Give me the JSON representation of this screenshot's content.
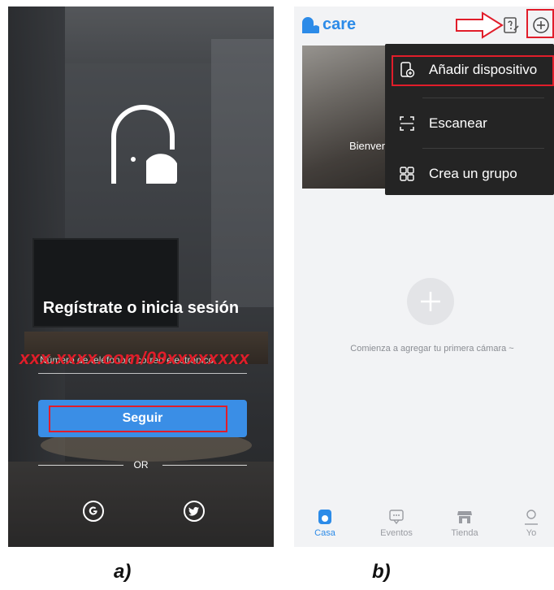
{
  "panel_a": {
    "title": "Regístrate o inicia sesión",
    "phone_placeholder": "Número de teléfono o correo electrónico",
    "redacted_overlay": "xxx.xxxx.com/09xxxxxxxx",
    "continue_label": "Seguir",
    "or_label": "OR",
    "caption": "a)",
    "icons": [
      "house-logo-icon",
      "google-icon",
      "twitter-icon"
    ]
  },
  "panel_b": {
    "app_name": "care",
    "banner_text": "Bienvenido a usar care",
    "menu": {
      "items": [
        {
          "label": "Añadir dispositivo",
          "icon": "add-device-icon"
        },
        {
          "label": "Escanear",
          "icon": "scan-icon"
        },
        {
          "label": "Crea un grupo",
          "icon": "group-icon"
        }
      ]
    },
    "empty_state_text": "Comienza a agregar tu primera cámara ~",
    "nav": [
      {
        "label": "Casa",
        "icon": "home-icon",
        "active": true
      },
      {
        "label": "Eventos",
        "icon": "events-icon",
        "active": false
      },
      {
        "label": "Tienda",
        "icon": "store-icon",
        "active": false
      },
      {
        "label": "Yo",
        "icon": "profile-icon",
        "active": false
      }
    ],
    "caption": "b)"
  },
  "colors": {
    "accent": "#2c8be8",
    "button": "#3a8ee6",
    "highlight": "#e11d2a",
    "menu_bg": "#242424"
  }
}
